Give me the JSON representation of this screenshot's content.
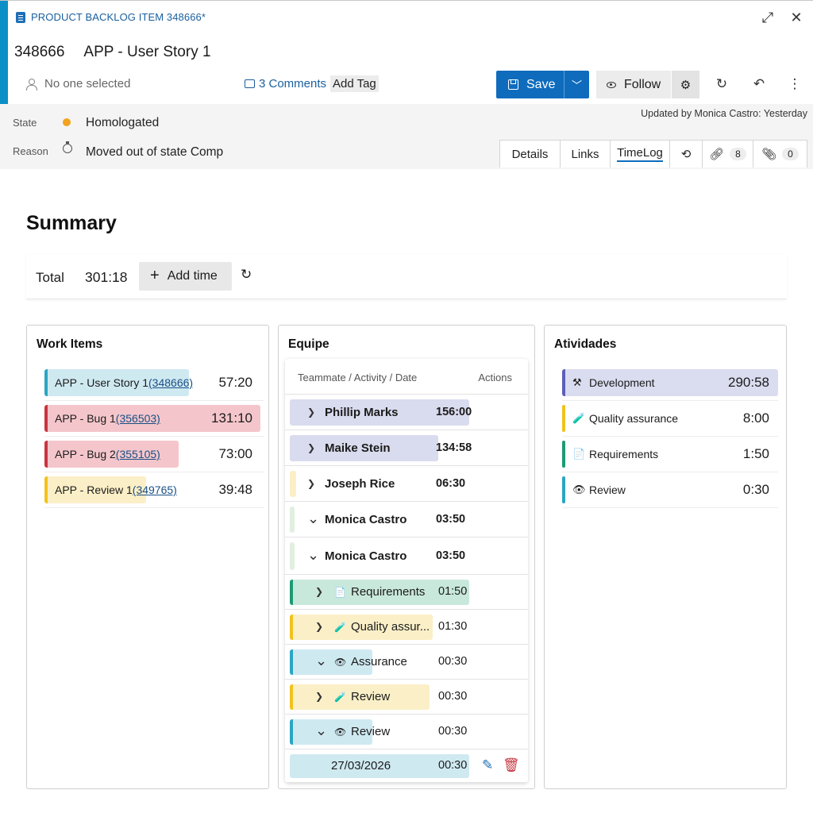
{
  "header": {
    "type_label": "PRODUCT BACKLOG ITEM 348666*",
    "id": "348666",
    "title": "APP - User Story 1",
    "assignee": "No one selected",
    "comments": "3 Comments",
    "add_tag": "Add Tag",
    "save_label": "Save",
    "follow_label": "Follow"
  },
  "fields": {
    "state_label": "State",
    "state_value": "Homologated",
    "state_color": "#f2a21c",
    "reason_label": "Reason",
    "reason_value": "Moved out of state Comp",
    "updated": "Updated by Monica Castro: Yesterday"
  },
  "tabs": {
    "details": "Details",
    "links": "Links",
    "timelog": "TimeLog",
    "links_count": "8",
    "attachments_count": "0",
    "active": "TimeLog"
  },
  "summary": {
    "title": "Summary",
    "total_label": "Total",
    "total_value": "301:18",
    "add_time": "Add time"
  },
  "work_items": {
    "title": "Work Items",
    "items": [
      {
        "prefix": "APP - User Story 1",
        "id": "(348666)",
        "time": "57:20",
        "color": "#2ba5c4",
        "fill": "#cfe9f1",
        "fill_fraction": 0.67
      },
      {
        "prefix": "APP - Bug 1",
        "id": "(356503)",
        "time": "131:10",
        "color": "#c9353f",
        "fill": "#f4c6cb",
        "fill_fraction": 1.0
      },
      {
        "prefix": "APP - Bug 2",
        "id": "(355105)",
        "time": "73:00",
        "color": "#c9353f",
        "fill": "#f4c6cb",
        "fill_fraction": 0.62
      },
      {
        "prefix": "APP - Review 1",
        "id": "(349765)",
        "time": "39:48",
        "color": "#f2c21c",
        "fill": "#fbefc7",
        "fill_fraction": 0.47
      }
    ]
  },
  "equipe": {
    "title": "Equipe",
    "col_teammate": "Teammate / Activity / Date",
    "col_actions": "Actions",
    "rows": [
      {
        "label": "Phillip Marks",
        "time": "156:00",
        "level": 0,
        "chevron": "›"
      },
      {
        "label": "Maike Stein",
        "time": "134:58",
        "level": 0,
        "chevron": "›"
      },
      {
        "label": "Joseph Rice",
        "time": "06:30",
        "level": 0,
        "chevron": "›"
      },
      {
        "label": "Monica Castro",
        "time": "03:50",
        "level": 0,
        "chevron": "⌄"
      },
      {
        "label": "Monica Castro",
        "time": "03:50",
        "level": 0,
        "chevron": "⌄"
      },
      {
        "label": "Requirements",
        "time": "01:50",
        "level": 1,
        "chevron": "›",
        "icon": "📄"
      },
      {
        "label": "Quality assur...",
        "time": "01:30",
        "level": 1,
        "chevron": "›",
        "icon": "🧪"
      },
      {
        "label": "Assurance",
        "time": "00:30",
        "level": 1,
        "chevron": "⌄",
        "icon": "👁"
      },
      {
        "label": "Review",
        "time": "00:30",
        "level": 1,
        "chevron": "›",
        "icon": "🧪"
      },
      {
        "label": "Review",
        "time": "00:30",
        "level": 1,
        "chevron": "⌄",
        "icon": "👁"
      },
      {
        "label": "27/03/2026",
        "time": "00:30",
        "level": 2
      }
    ],
    "edit_icon": "pencil-icon",
    "delete_icon": "trash-icon"
  },
  "atividades": {
    "title": "Atividades",
    "items": [
      {
        "label": "Development",
        "time": "290:58",
        "icon": "⚒",
        "color": "#5c5fb8",
        "fill": "#dadcef"
      },
      {
        "label": "Quality assurance",
        "time": "8:00",
        "icon": "🧪",
        "color": "#f2c21c",
        "fill": ""
      },
      {
        "label": "Requirements",
        "time": "1:50",
        "icon": "📄",
        "color": "#1d9a74",
        "fill": ""
      },
      {
        "label": "Review",
        "time": "0:30",
        "icon": "👁",
        "color": "#2ba5c4",
        "fill": ""
      }
    ]
  }
}
